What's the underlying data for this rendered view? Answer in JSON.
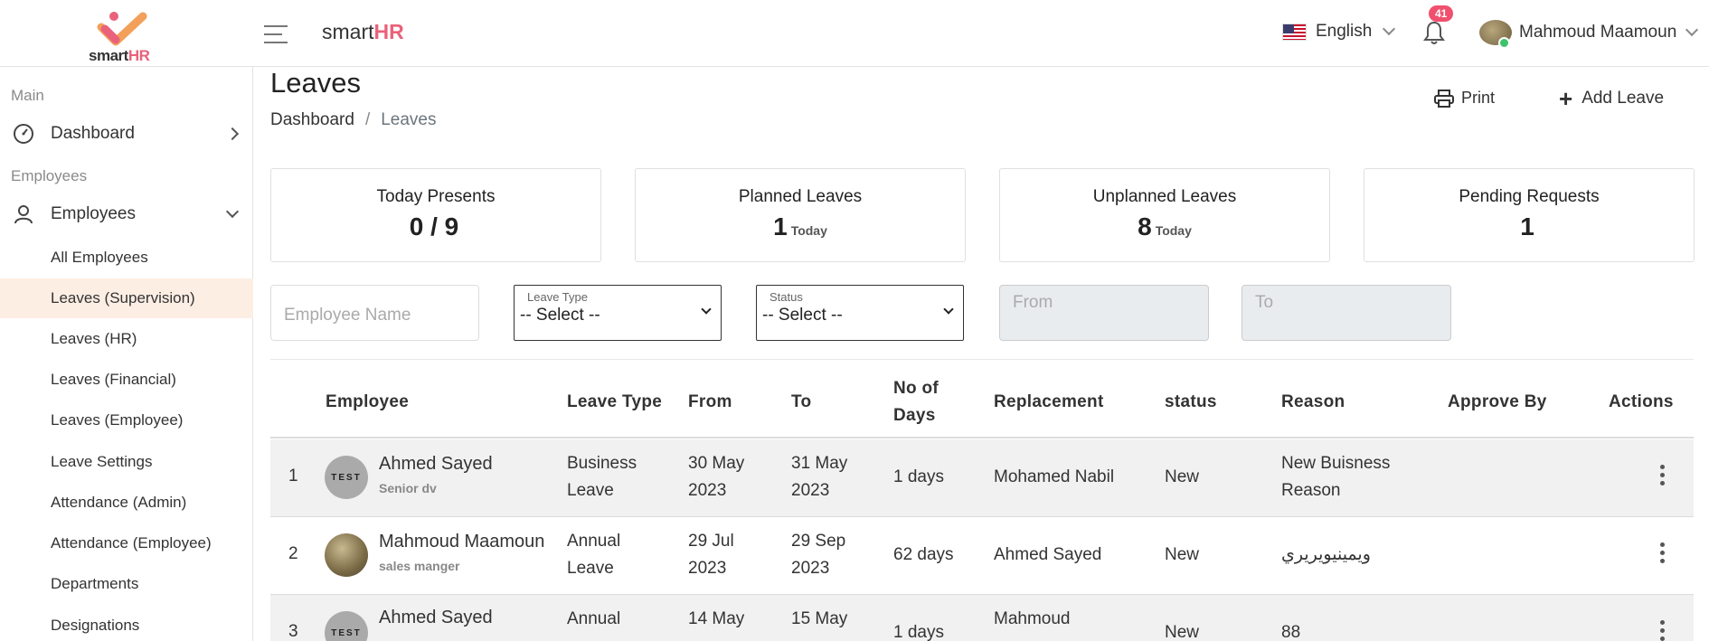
{
  "brand": {
    "logo_smart": "smart",
    "logo_hr": "HR",
    "title_smart": "smart",
    "title_hr": "HR"
  },
  "header": {
    "language": "English",
    "notifications_count": "41",
    "user_name": "Mahmoud Maamoun"
  },
  "sidebar": {
    "section_main": "Main",
    "dashboard": "Dashboard",
    "section_employees": "Employees",
    "employees": "Employees",
    "items": [
      {
        "label": "All Employees"
      },
      {
        "label": "Leaves (Supervision)"
      },
      {
        "label": "Leaves (HR)"
      },
      {
        "label": "Leaves (Financial)"
      },
      {
        "label": "Leaves (Employee)"
      },
      {
        "label": "Leave Settings"
      },
      {
        "label": "Attendance (Admin)"
      },
      {
        "label": "Attendance (Employee)"
      },
      {
        "label": "Departments"
      },
      {
        "label": "Designations"
      }
    ]
  },
  "page": {
    "title": "Leaves",
    "breadcrumb_home": "Dashboard",
    "breadcrumb_sep": "/",
    "breadcrumb_current": "Leaves",
    "print_label": "Print",
    "add_label": "Add Leave"
  },
  "stats": [
    {
      "title": "Today Presents",
      "value": "0 / 9",
      "suffix": ""
    },
    {
      "title": "Planned Leaves",
      "value": "1",
      "suffix": "Today"
    },
    {
      "title": "Unplanned Leaves",
      "value": "8",
      "suffix": "Today"
    },
    {
      "title": "Pending Requests",
      "value": "1",
      "suffix": ""
    }
  ],
  "filters": {
    "employee_placeholder": "Employee Name",
    "leave_type_label": "Leave Type",
    "leave_type_value": "-- Select --",
    "status_label": "Status",
    "status_value": "-- Select --",
    "from_placeholder": "From",
    "to_placeholder": "To"
  },
  "table": {
    "headers": {
      "employee": "Employee",
      "leave_type": "Leave Type",
      "from": "From",
      "to": "To",
      "days_1": "No of",
      "days_2": "Days",
      "replacement": "Replacement",
      "status": "status",
      "reason": "Reason",
      "approve_by": "Approve By",
      "actions": "Actions"
    },
    "rows": [
      {
        "num": "1",
        "avatar_text": "TEST",
        "name": "Ahmed Sayed",
        "role": "Senior dv",
        "type_1": "Business",
        "type_2": "Leave",
        "from_1": "30 May",
        "from_2": "2023",
        "to_1": "31 May",
        "to_2": "2023",
        "days": "1 days",
        "replacement": "Mohamed Nabil",
        "status": "New",
        "reason_1": "New Buisness",
        "reason_2": "Reason"
      },
      {
        "num": "2",
        "avatar_text": "",
        "name": "Mahmoud Maamoun",
        "role": "sales manger",
        "type_1": "Annual",
        "type_2": "Leave",
        "from_1": "29 Jul",
        "from_2": "2023",
        "to_1": "29 Sep",
        "to_2": "2023",
        "days": "62 days",
        "replacement": "Ahmed Sayed",
        "status": "New",
        "reason_1": "ويمينيويريري",
        "reason_2": ""
      },
      {
        "num": "3",
        "avatar_text": "TEST",
        "name": "Ahmed Sayed",
        "role": "",
        "type_1": "Annual",
        "type_2": "",
        "from_1": "14 May",
        "from_2": "",
        "to_1": "15 May",
        "to_2": "",
        "days": "1 days",
        "replacement": "Mahmoud",
        "status": "New",
        "reason_1": "88",
        "reason_2": ""
      }
    ]
  }
}
